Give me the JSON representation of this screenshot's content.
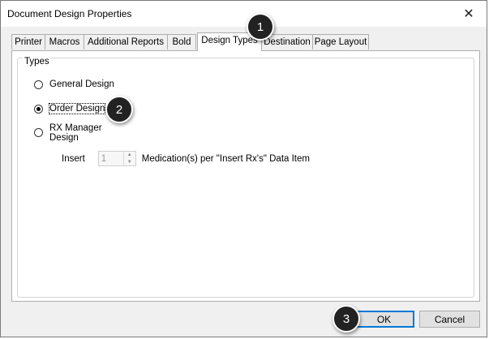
{
  "window": {
    "title": "Document Design Properties",
    "close_glyph": "✕"
  },
  "tabs": [
    {
      "label": "Printer"
    },
    {
      "label": "Macros"
    },
    {
      "label": "Additional Reports"
    },
    {
      "label": "Bold"
    },
    {
      "label": "Design Types",
      "active": true
    },
    {
      "label": "Destination"
    },
    {
      "label": "Page Layout"
    }
  ],
  "types_group": {
    "label": "Types",
    "options": [
      {
        "label": "General Design",
        "checked": false
      },
      {
        "label": "Order Design",
        "checked": true
      },
      {
        "label": "RX Manager Design",
        "line1": "RX Manager",
        "line2": "Design",
        "checked": false
      }
    ],
    "insert": {
      "prefix": "Insert",
      "value": "1",
      "suffix": "Medication(s) per \"Insert Rx's\" Data Item"
    }
  },
  "buttons": {
    "ok": "OK",
    "cancel": "Cancel"
  },
  "callouts": [
    "1",
    "2",
    "3"
  ],
  "icons": {
    "close": "close-icon",
    "spin_up": "spin-up-icon",
    "spin_down": "spin-down-icon"
  }
}
